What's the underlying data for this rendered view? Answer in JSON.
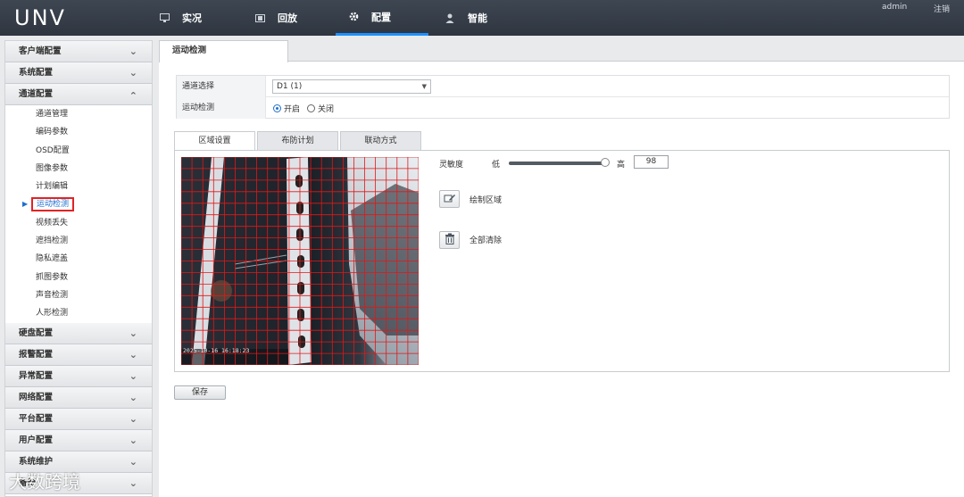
{
  "brand": {
    "logo": "UNV"
  },
  "nav": [
    {
      "label": "实况",
      "icon": "monitor-icon"
    },
    {
      "label": "回放",
      "icon": "film-icon"
    },
    {
      "label": "配置",
      "icon": "gear-icon"
    },
    {
      "label": "智能",
      "icon": "person-icon"
    }
  ],
  "user": {
    "name": "admin",
    "logout": "注销"
  },
  "sidebar": {
    "groups_top": [
      {
        "label": "客户端配置"
      },
      {
        "label": "系统配置"
      },
      {
        "label": "通道配置"
      }
    ],
    "channel_items": [
      {
        "label": "通道管理"
      },
      {
        "label": "编码参数"
      },
      {
        "label": "OSD配置"
      },
      {
        "label": "图像参数"
      },
      {
        "label": "计划编辑"
      },
      {
        "label": "运动检测"
      },
      {
        "label": "视频丢失"
      },
      {
        "label": "遮挡检测"
      },
      {
        "label": "隐私遮盖"
      },
      {
        "label": "抓图参数"
      },
      {
        "label": "声音检测"
      },
      {
        "label": "人形检测"
      }
    ],
    "groups_bottom": [
      {
        "label": "硬盘配置"
      },
      {
        "label": "报警配置"
      },
      {
        "label": "异常配置"
      },
      {
        "label": "网络配置"
      },
      {
        "label": "平台配置"
      },
      {
        "label": "用户配置"
      },
      {
        "label": "系统维护"
      },
      {
        "label": "备份"
      }
    ]
  },
  "page": {
    "tab": "运动检测",
    "channel_label": "通道选择",
    "channel_value": "D1 (1)",
    "motion_label": "运动检测",
    "motion_on": "开启",
    "motion_off": "关闭",
    "sub_tabs": [
      "区域设置",
      "布防计划",
      "联动方式"
    ],
    "sensitivity_label": "灵敏度",
    "sensitivity_low": "低",
    "sensitivity_high": "高",
    "sensitivity_value": "98",
    "draw_area": "绘制区域",
    "clear_all": "全部清除",
    "save": "保存",
    "video_timestamp": "2025-10-16 16:18:23"
  },
  "watermark": "大数跨境",
  "colors": {
    "accent": "#1e6fd0",
    "grid": "#e01818",
    "topbar": "#353c46",
    "highlight": "#e02424"
  }
}
